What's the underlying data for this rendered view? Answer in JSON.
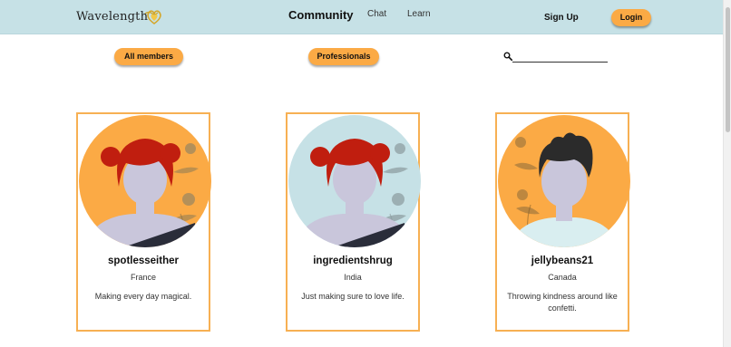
{
  "header": {
    "logo_text": "Wavelength",
    "nav": {
      "community": "Community",
      "chat": "Chat",
      "learn": "Learn"
    },
    "signup": "Sign Up",
    "login": "Login"
  },
  "filters": {
    "all_members": "All members",
    "professionals": "Professionals"
  },
  "search": {
    "placeholder": "",
    "value": ""
  },
  "members": [
    {
      "username": "spotlesseither",
      "country": "France",
      "bio": "Making every day magical.",
      "avatar": "woman-avatar",
      "avatar_bg": "#fbaa45"
    },
    {
      "username": "ingredientshrug",
      "country": "India",
      "bio": "Just making sure to love life.",
      "avatar": "woman-avatar",
      "avatar_bg": "#c6e1e6"
    },
    {
      "username": "jellybeans21",
      "country": "Canada",
      "bio": "Throwing kindness around like confetti.",
      "avatar": "man-avatar",
      "avatar_bg": "#fbaa45"
    }
  ],
  "colors": {
    "header_bg": "#c6e1e6",
    "accent": "#fbaa45",
    "card_border": "#f7b053"
  }
}
